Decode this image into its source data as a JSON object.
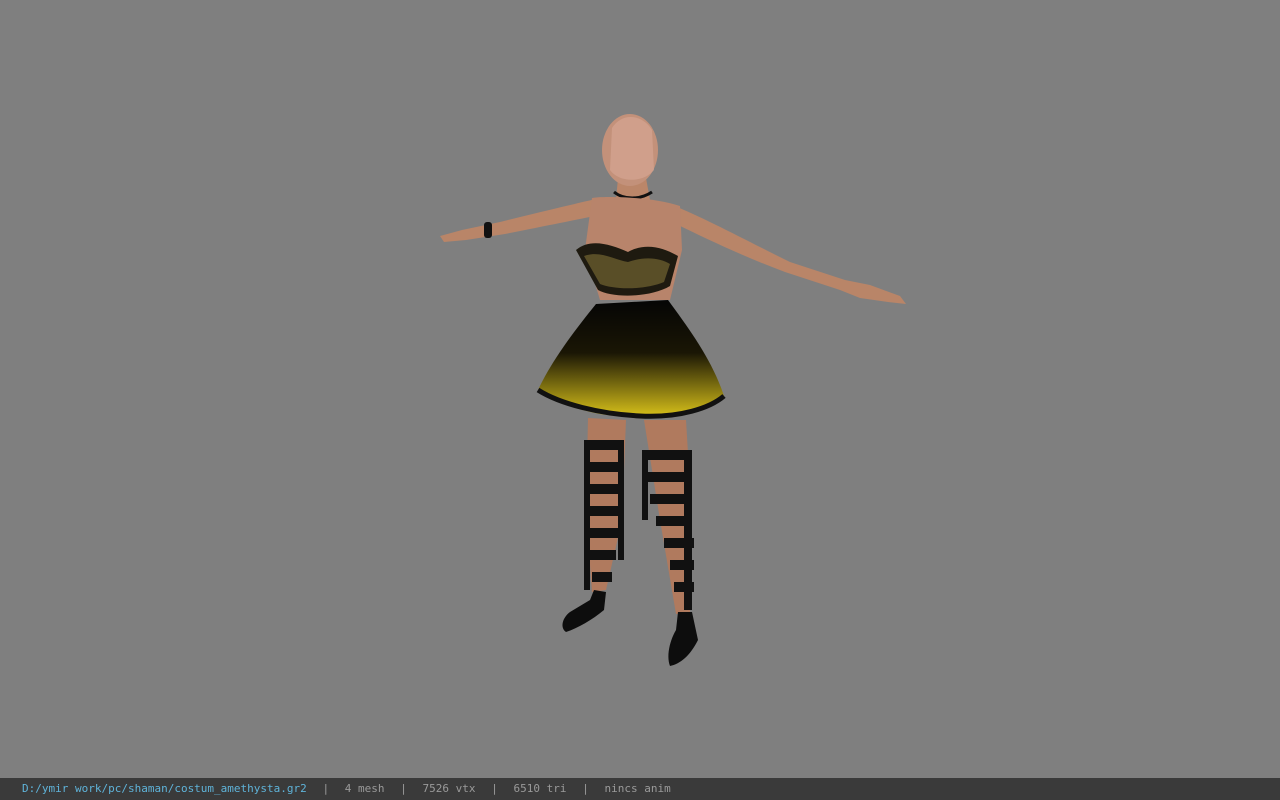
{
  "viewer": {
    "background_color": "#7f7f7f",
    "model": "character-model"
  },
  "status_bar": {
    "file_path": "D:/ymir work/pc/shaman/costum_amethysta.gr2",
    "separator": "|",
    "mesh_count": "4 mesh",
    "vertex_count": "7526 vtx",
    "triangle_count": "6510 tri",
    "animation": "nincs anim",
    "path_color": "#5fb3d9",
    "bar_color": "#3a3a3a"
  }
}
